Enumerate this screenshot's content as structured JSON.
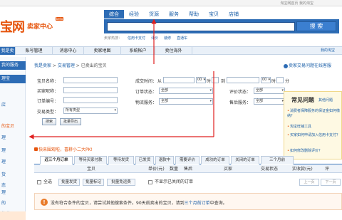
{
  "topbar": {
    "links": "淘宝网首页   我的淘宝"
  },
  "logo": {
    "main": "宝网",
    "sub": "卖家中心",
    "badge": "beta"
  },
  "nav_tabs": [
    "综合",
    "经验",
    "货源",
    "服务",
    "帮助",
    "宝贝",
    "店铺"
  ],
  "search": {
    "button": "搜 索",
    "hot_label": "卖家热搜：",
    "hot_words": [
      "信用卡支付",
      "评价",
      "装修",
      "直通车"
    ]
  },
  "main_nav": {
    "items": [
      "我是卖家",
      "账号管理",
      "消息中心",
      "卖家地图",
      "系统帐户",
      "卖住海外"
    ],
    "right": "我的淘宝"
  },
  "sidebar": {
    "heads": [
      "我的服务",
      "理宝"
    ],
    "items": [
      "店",
      "的宝贝",
      "理",
      "理",
      "理",
      "货",
      "态",
      "理",
      "的",
      "快递",
      "理",
      "宝",
      "理",
      "态"
    ]
  },
  "breadcrumb": {
    "home": "我是卖家",
    "section": "交易管理",
    "current": "已卖出的宝贝",
    "sep": " > "
  },
  "help_link": "卖家交易问题在线客服",
  "form": {
    "labels": {
      "item_name": "宝贝名称：",
      "buyer_nick": "买家昵称：",
      "order_no": "订单编号：",
      "trade_type": "交易类型：",
      "time": "成交时间：",
      "from": "从",
      "to": "到",
      "order_status": "订单状态：",
      "logistics": "物流服务：",
      "rate_status": "评价状态：",
      "after_sale": "售后服务："
    },
    "trade_type_value": "所有类型",
    "select_all": "全部",
    "time_hour": "00",
    "hour_unit": "时",
    "minute_unit": "分",
    "search_button": "搜索",
    "export_button": "批量导出"
  },
  "faq": {
    "title": "常见问题",
    "more": "其他问题",
    "questions": [
      "消费者保障服务的保证金如何缴纳？",
      "淘宝旺铺工具",
      "买家如何申请加入信用卡支付？",
      "如何修改删除评价？"
    ]
  },
  "promo": "快来围观啦，喜耕小二大PK!",
  "order_tabs": [
    "近三个月订单",
    "等待买家付款",
    "等待发货",
    "已发货",
    "退款中",
    "需要评价",
    "成功的订单",
    "关闭的订单",
    "三个月前"
  ],
  "table_header": [
    "宝贝",
    "单价(元)",
    "数量",
    "售后",
    "买家",
    "交易状态",
    "实收款(元)",
    "评"
  ],
  "batch": {
    "select_all": "全选",
    "buttons": [
      "批量发货",
      "批量标记",
      "批量免运费"
    ],
    "hide_closed": "不显示已关闭的订单",
    "prev": "上一页",
    "next": "下一页"
  },
  "notice": {
    "icon": "!",
    "text": "没有符合条件的宝贝，请尝试其他搜索条件。90天前卖出的宝贝，请到",
    "link": "三个月前订单",
    "tail": "中查询。"
  },
  "colors": {
    "brand_orange": "#e6550d",
    "nav_blue": "#2d6cb5",
    "link_blue": "#1b5fa8",
    "faq_bg": "#fef9e3"
  }
}
